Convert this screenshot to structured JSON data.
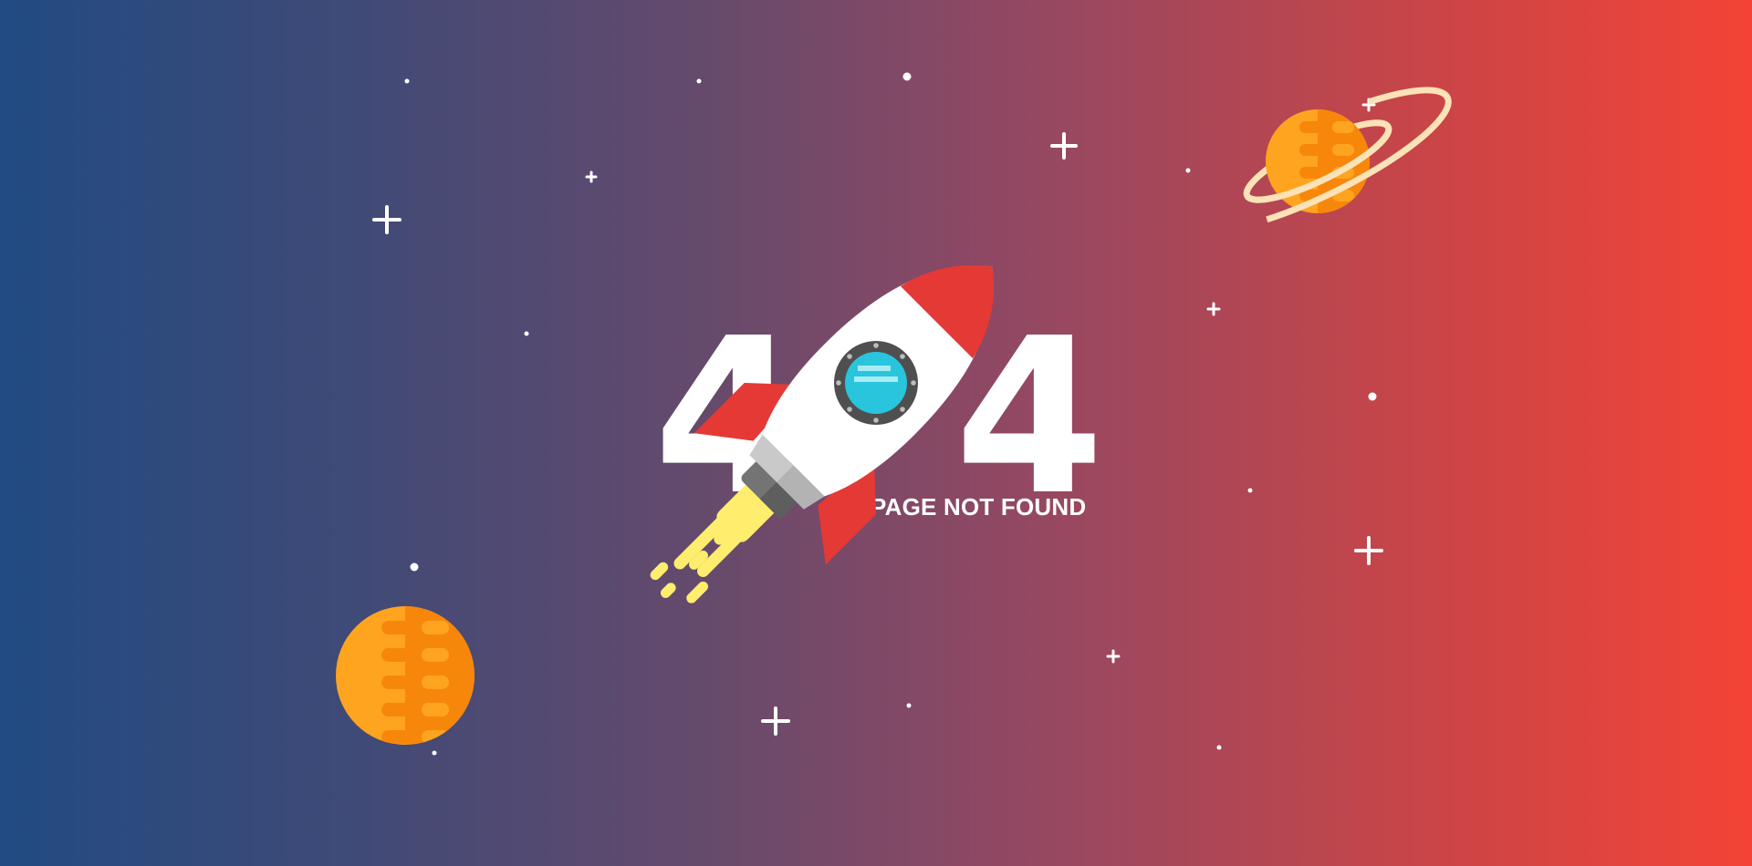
{
  "error": {
    "code_digit_left": "4",
    "code_digit_right": "4",
    "message": "PAGE NOT FOUND"
  },
  "illustration": {
    "rocket_icon": "rocket-icon",
    "planet_icons": [
      "ringed-planet-icon",
      "planet-icon"
    ],
    "star_icons": "sparkle-star-icon",
    "colors": {
      "background_left": "#214b82",
      "background_right": "#f44336",
      "rocket_red": "#e53935",
      "rocket_window": "#29c5dc",
      "flame": "#ffee6e",
      "planet": "#ffa41f"
    }
  }
}
